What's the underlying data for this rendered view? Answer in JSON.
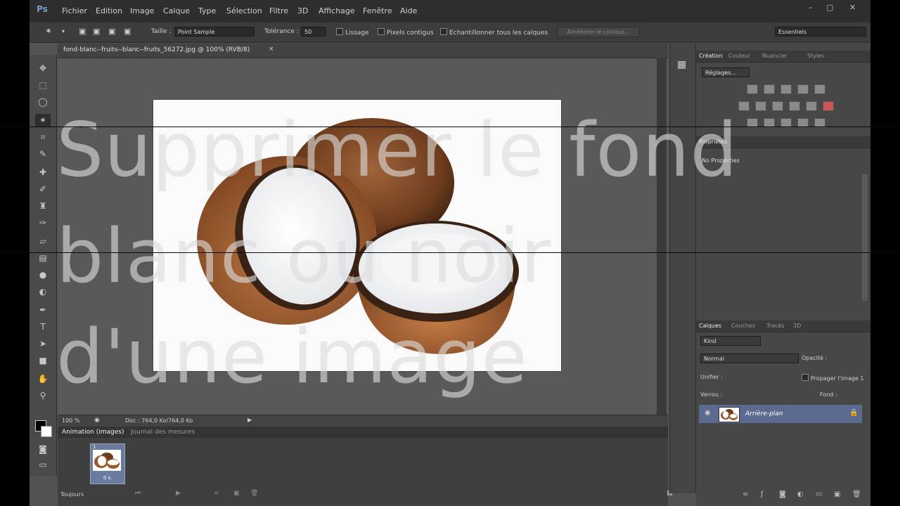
{
  "menubar": {
    "logo": "Ps",
    "items": [
      "Fichier",
      "Edition",
      "Image",
      "Calque",
      "Type",
      "Sélection",
      "Filtre",
      "3D",
      "Affichage",
      "Fenêtre",
      "Aide"
    ],
    "window_controls": [
      "–",
      "▢",
      "✕"
    ]
  },
  "options": {
    "taille_label": "Taille :",
    "taille_value": "Point Sample",
    "tolerance_label": "Tolérance :",
    "tolerance_value": "50",
    "lissage_label": "Lissage",
    "pixels_contigus_label": "Pixels contigus",
    "echantillonner_label": "Echantillonner tous les calques",
    "ameliorer_label": "Améliorer le contour...",
    "workspace_label": "Essentiels"
  },
  "document": {
    "tab_label": "fond-blanc--fruits--blanc--fruits_56272.jpg @ 100% (RVB/8)",
    "zoom": "100 %",
    "doc_size": "Doc : 764,0 Ko/764,0 Ko"
  },
  "bottom_panel": {
    "tabs": [
      "Animation (images)",
      "Journal des mesures"
    ],
    "frame_number": "1",
    "frame_delay": "0 s.",
    "loop": "Toujours"
  },
  "right_panels": {
    "top_tabs": [
      "Création",
      "Couleur",
      "Nuancier",
      "Styles"
    ],
    "adjustments_dropdown": "Réglages...",
    "properties_tab": "Propriétés",
    "properties_text": "No Properties",
    "layers_tabs": [
      "Calques",
      "Couches",
      "Tracés",
      "3D"
    ],
    "layers_kind": "Kind",
    "blend_mode": "Normal",
    "opacity_label": "Opacité :",
    "unifier_label": "Unifier :",
    "propager_label": "Propager l'image 1",
    "verrou_label": "Verrou :",
    "fond_label": "Fond :",
    "layer_name": "Arrière-plan"
  },
  "overlay": {
    "line1": "Supprimer le fond",
    "line2": "blanc ou noir",
    "line3": "d'une image"
  },
  "colors": {
    "ps_bg": "#535353",
    "menubar": "#2e2e2e",
    "accent_layer": "#5c6a90",
    "overlay_text": "#dcdcdc"
  }
}
